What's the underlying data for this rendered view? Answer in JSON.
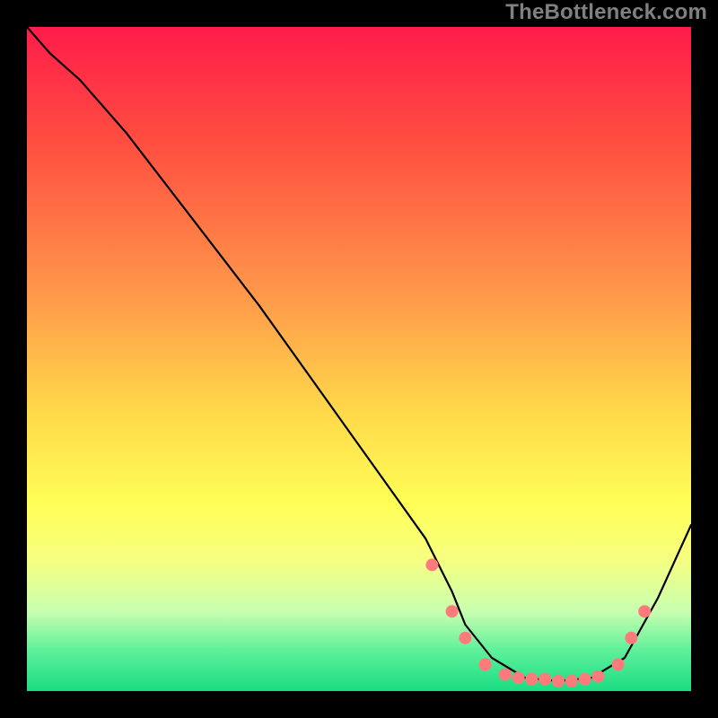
{
  "watermark": "TheBottleneck.com",
  "colors": {
    "page_bg": "#000000",
    "watermark": "#808080",
    "curve": "#000000",
    "dot": "#ff7a7a",
    "gradient_stops": [
      {
        "pos": 0.0,
        "color": "#ff1c4a"
      },
      {
        "pos": 0.18,
        "color": "#ff5040"
      },
      {
        "pos": 0.4,
        "color": "#ff974a"
      },
      {
        "pos": 0.58,
        "color": "#ffd94a"
      },
      {
        "pos": 0.72,
        "color": "#ffff57"
      },
      {
        "pos": 0.8,
        "color": "#f7ff80"
      },
      {
        "pos": 0.88,
        "color": "#c8ffb0"
      },
      {
        "pos": 0.94,
        "color": "#5df09a"
      },
      {
        "pos": 1.0,
        "color": "#1adc82"
      }
    ]
  },
  "chart_data": {
    "type": "line",
    "title": "",
    "xlabel": "",
    "ylabel": "",
    "xlim": [
      0,
      100
    ],
    "ylim": [
      0,
      100
    ],
    "grid": false,
    "legend": false,
    "note": "Axis ticks/labels are not rendered. x and y values are read in percent of the plot area: x=0 left→100 right, y=0 bottom→100 top.",
    "series": [
      {
        "name": "curve",
        "kind": "line",
        "x": [
          0,
          3.5,
          8,
          15,
          25,
          35,
          45,
          55,
          60,
          62,
          64,
          66,
          70,
          75,
          80,
          85,
          90,
          95,
          100
        ],
        "y": [
          100,
          96,
          92,
          84,
          71,
          58,
          44,
          30,
          23,
          19,
          15,
          10,
          5,
          2,
          1.5,
          2,
          5,
          14,
          25
        ]
      },
      {
        "name": "dots",
        "kind": "scatter",
        "x": [
          61,
          64,
          66,
          69,
          72,
          74,
          76,
          78,
          80,
          82,
          84,
          86,
          89,
          91,
          93
        ],
        "y": [
          19,
          12,
          8,
          4,
          2.5,
          2,
          1.8,
          1.8,
          1.5,
          1.5,
          1.8,
          2.2,
          4,
          8,
          12
        ]
      }
    ]
  }
}
